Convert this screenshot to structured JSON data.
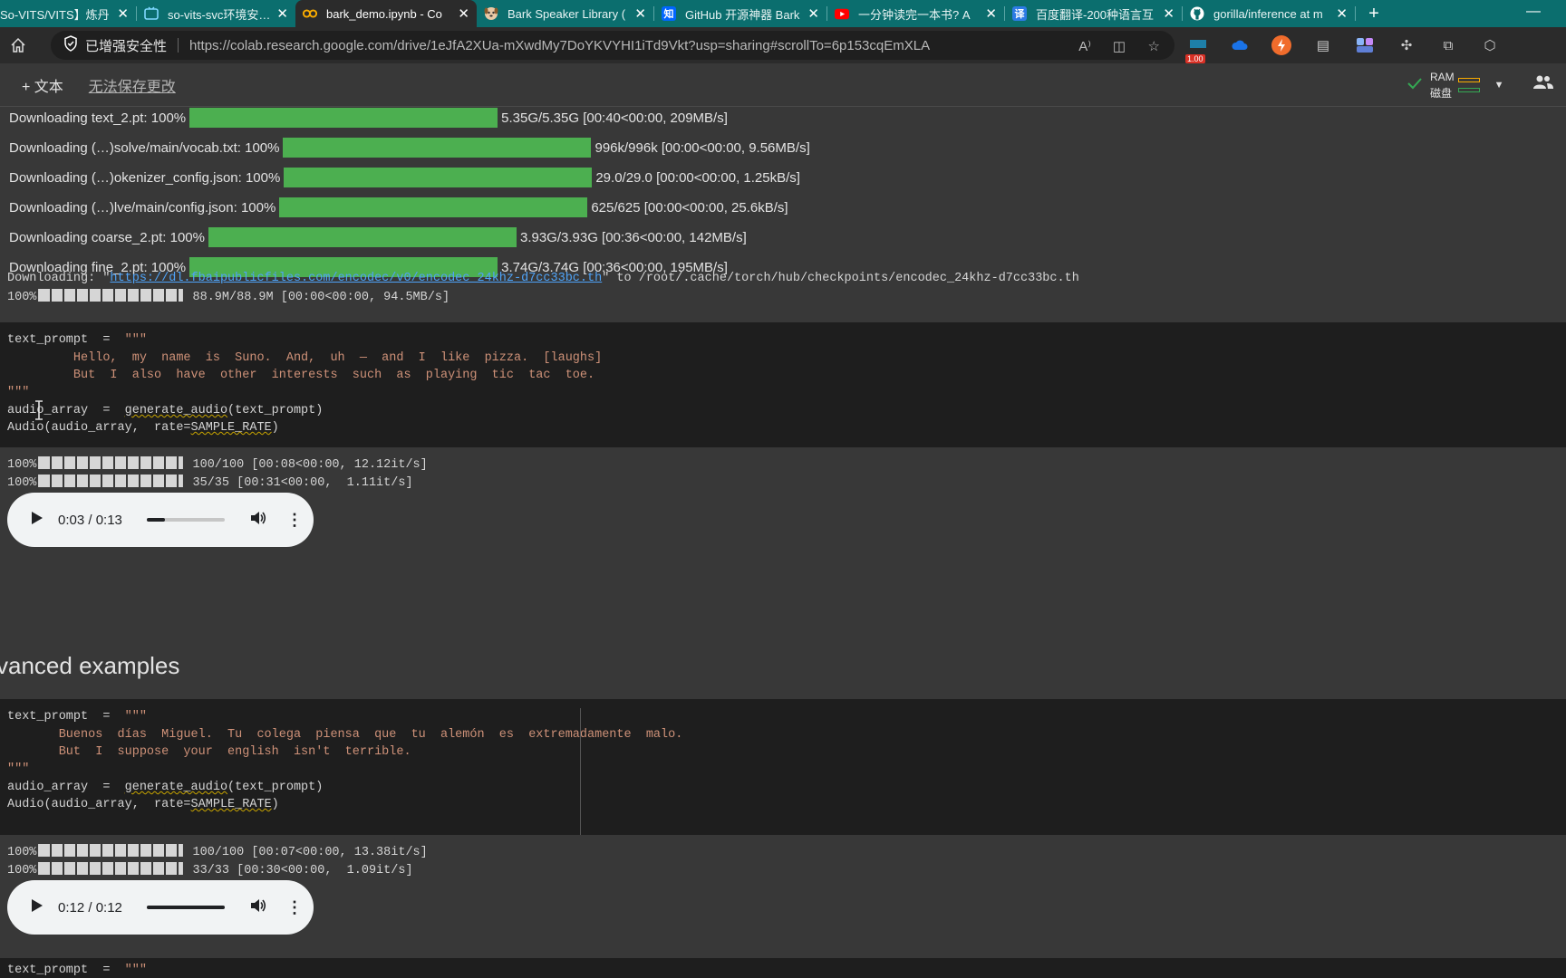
{
  "browser": {
    "tabs": [
      {
        "title": "So-VITS/VITS】炼丹",
        "favicon": "bili-icon",
        "color": "#00a1d6"
      },
      {
        "title": "so-vits-svc环境安装和",
        "favicon": "bilibili-tv-icon",
        "color": "#00a1d6"
      },
      {
        "title": "bark_demo.ipynb - Co",
        "favicon": "colab-icon",
        "color": "#f9ab00",
        "active": true
      },
      {
        "title": "Bark Speaker Library (",
        "favicon": "dog-icon",
        "color": "#c98a4b"
      },
      {
        "title": "GitHub 开源神器 Bark",
        "favicon": "zhihu-icon",
        "color": "#0066ff",
        "glyph": "知"
      },
      {
        "title": "一分钟读完一本书? A",
        "favicon": "youtube-icon",
        "color": "#ff0000"
      },
      {
        "title": "百度翻译-200种语言互",
        "favicon": "baidu-translate-icon",
        "color": "#2d7be5",
        "glyph": "译"
      },
      {
        "title": "gorilla/inference at m",
        "favicon": "github-icon",
        "color": "#ffffff"
      }
    ],
    "new_tab": "+",
    "minimize": "—",
    "security_label": "已增强安全性",
    "url": "https://colab.research.google.com/drive/1eJfA2XUa-mXwdMy7DoYKVYHI1iTd9Vkt?usp=sharing#scrollTo=6p153cqEmXLA",
    "badge": "1.00"
  },
  "toolbar": {
    "add_text": "+ 文本",
    "unsaved": "无法保存更改",
    "ram_label": "RAM",
    "disk_label": "磁盘"
  },
  "downloads": [
    {
      "label": "Downloading text_2.pt: 100%",
      "stats": "5.35G/5.35G [00:40<00:00, 209MB/s]"
    },
    {
      "label": "Downloading (…)solve/main/vocab.txt: 100%",
      "stats": "996k/996k [00:00<00:00, 9.56MB/s]"
    },
    {
      "label": "Downloading (…)okenizer_config.json: 100%",
      "stats": "29.0/29.0 [00:00<00:00, 1.25kB/s]"
    },
    {
      "label": "Downloading (…)lve/main/config.json: 100%",
      "stats": "625/625 [00:00<00:00, 25.6kB/s]"
    },
    {
      "label": "Downloading coarse_2.pt: 100%",
      "stats": "3.93G/3.93G [00:36<00:00, 142MB/s]"
    },
    {
      "label": "Downloading fine_2.pt: 100%",
      "stats": "3.74G/3.74G [00:36<00:00, 195MB/s]"
    }
  ],
  "encodec": {
    "prefix": "Downloading: \"",
    "link": "https://dl.fbaipublicfiles.com/encodec/v0/encodec_24khz-d7cc33bc.th",
    "suffix": "\" to /root/.cache/torch/hub/checkpoints/encodec_24khz-d7cc33bc.th",
    "pct": "100%",
    "stats": " 88.9M/88.9M [00:00<00:00, 94.5MB/s]"
  },
  "cell1": {
    "l1_var": "text_prompt  =  ",
    "l1_quote": "\"\"\"",
    "l2": "         Hello,  my  name  is  Suno.  And,  uh  —  and  I  like  pizza.  [laughs]",
    "l3": "         But  I  also  have  other  interests  such  as  playing  tic  tac  toe.",
    "l4": "\"\"\"",
    "l5_a": "audio_array  =  ",
    "l5_fn": "generate_audio",
    "l5_b": "(text_prompt)",
    "l6_a": "Audio(audio_array,  rate=",
    "l6_b": "SAMPLE_RATE",
    "l6_c": ")"
  },
  "cell1_out": {
    "p1_pct": "100%",
    "p1_stats": " 100/100 [00:08<00:00, 12.12it/s]",
    "p2_pct": "100%",
    "p2_stats": " 35/35 [00:31<00:00,  1.11it/s]",
    "player_time": "0:03 / 0:13",
    "player_progress": 0.23
  },
  "section_heading": "vanced examples",
  "cell2": {
    "l1_var": "text_prompt  =  ",
    "l1_quote": "\"\"\"",
    "l2": "       Buenos  días  Miguel.  Tu  colega  piensa  que  tu  alemón  es  extremadamente  malo.",
    "l3": "       But  I  suppose  your  english  isn't  terrible.",
    "l4": "\"\"\"",
    "l5_a": "audio_array  =  ",
    "l5_fn": "generate_audio",
    "l5_b": "(text_prompt)",
    "l6_a": "Audio(audio_array,  rate=",
    "l6_b": "SAMPLE_RATE",
    "l6_c": ")"
  },
  "cell2_out": {
    "p1_pct": "100%",
    "p1_stats": " 100/100 [00:07<00:00, 13.38it/s]",
    "p2_pct": "100%",
    "p2_stats": " 33/33 [00:30<00:00,  1.09it/s]",
    "player_time": "0:12 / 0:12",
    "player_progress": 1.0
  },
  "cell3": {
    "l1_var": "text_prompt  =  ",
    "l1_quote": "\"\"\""
  },
  "colors": {
    "progress_green": "#4caf50",
    "string": "#ce9178",
    "link": "#4fa3f7"
  }
}
